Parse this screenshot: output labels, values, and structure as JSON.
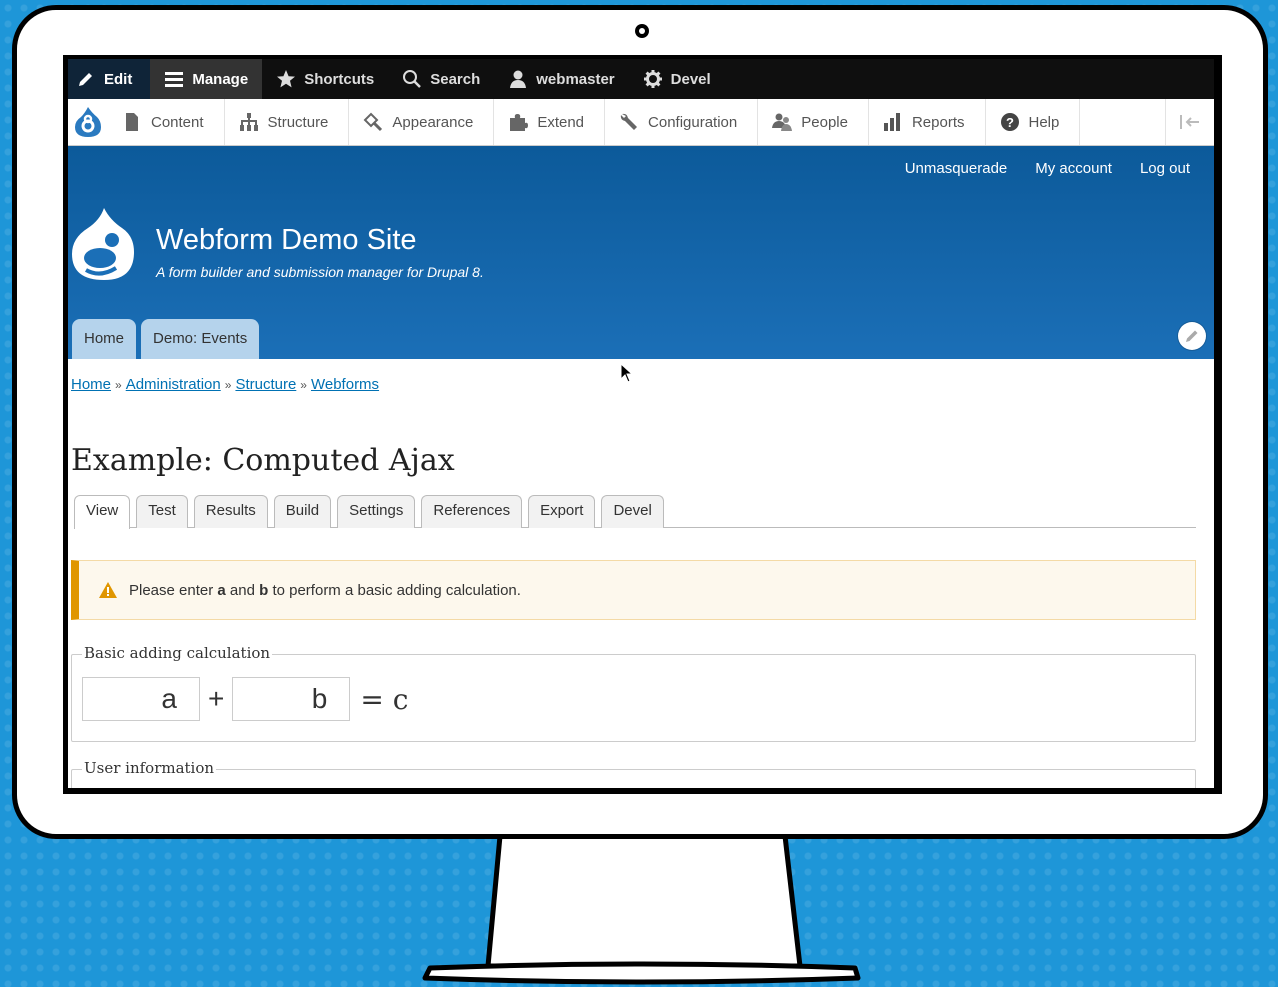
{
  "toolbar": {
    "edit": "Edit",
    "manage": "Manage",
    "shortcuts": "Shortcuts",
    "search": "Search",
    "user": "webmaster",
    "devel": "Devel"
  },
  "tray": {
    "items": [
      "Content",
      "Structure",
      "Appearance",
      "Extend",
      "Configuration",
      "People",
      "Reports",
      "Help"
    ]
  },
  "header": {
    "secondary_menu": [
      "Unmasquerade",
      "My account",
      "Log out"
    ],
    "site_name": "Webform Demo Site",
    "site_slogan": "A form builder and submission manager for Drupal 8.",
    "main_tabs": [
      "Home",
      "Demo: Events"
    ]
  },
  "breadcrumb": [
    "Home",
    "Administration",
    "Structure",
    "Webforms"
  ],
  "breadcrumb_separator": "»",
  "page_title": "Example: Computed Ajax",
  "tabs": [
    "View",
    "Test",
    "Results",
    "Build",
    "Settings",
    "References",
    "Export",
    "Devel"
  ],
  "active_tab": "View",
  "warning": {
    "prefix": "Please enter ",
    "a": "a",
    "middle": " and ",
    "b": "b",
    "suffix": " to perform a basic adding calculation."
  },
  "calc_fieldset": {
    "legend": "Basic adding calculation",
    "input_a": "a",
    "plus": "+",
    "input_b": "b",
    "result": "= c"
  },
  "user_fieldset": {
    "legend": "User information"
  },
  "colors": {
    "background": "#1e96d8",
    "header_blue": "#1b6fb7",
    "link": "#0071b3",
    "warning_border": "#e09600"
  }
}
